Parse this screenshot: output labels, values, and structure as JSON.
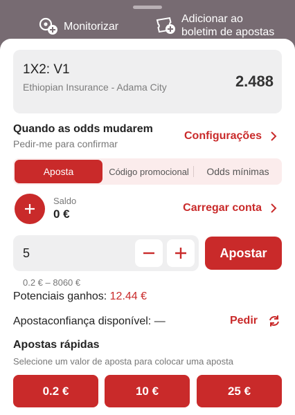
{
  "top_actions": {
    "monitor_label": "Monitorizar",
    "add_line1": "Adicionar ao",
    "add_line2": "boletim de apostas"
  },
  "selection": {
    "market": "1X2: V1",
    "event": "Ethiopian Insurance - Adama City",
    "odd": "2.488"
  },
  "odds_change": {
    "title": "Quando as odds mudarem",
    "subtitle": "Pedir-me para confirmar",
    "settings_label": "Configurações"
  },
  "tabs": [
    {
      "label": "Aposta",
      "active": true
    },
    {
      "label": "Código promocional",
      "active": false
    },
    {
      "label": "Odds mínimas",
      "active": false
    }
  ],
  "balance": {
    "label": "Saldo",
    "value": "0 €",
    "topup_label": "Carregar conta"
  },
  "stake": {
    "value": "5",
    "bet_label": "Apostar",
    "range": "0.2 € – 8060 €"
  },
  "potential": {
    "label": "Potenciais ganhos:",
    "amount": "12.44 €"
  },
  "confidence": {
    "label": "Apostaconfiança disponível: —",
    "ask_label": "Pedir"
  },
  "quick_bets": {
    "title": "Apostas rápidas",
    "subtitle": "Selecione um valor de aposta para colocar uma aposta",
    "values": [
      "0.2 €",
      "10 €",
      "25 €"
    ]
  },
  "colors": {
    "accent": "#c92a2a",
    "overlay": "#776b72",
    "card": "#efeff0"
  },
  "icons": [
    "monitor-plus-icon",
    "ticket-plus-icon",
    "chevron-right-icon",
    "plus-icon",
    "minus-icon",
    "refresh-icon"
  ]
}
